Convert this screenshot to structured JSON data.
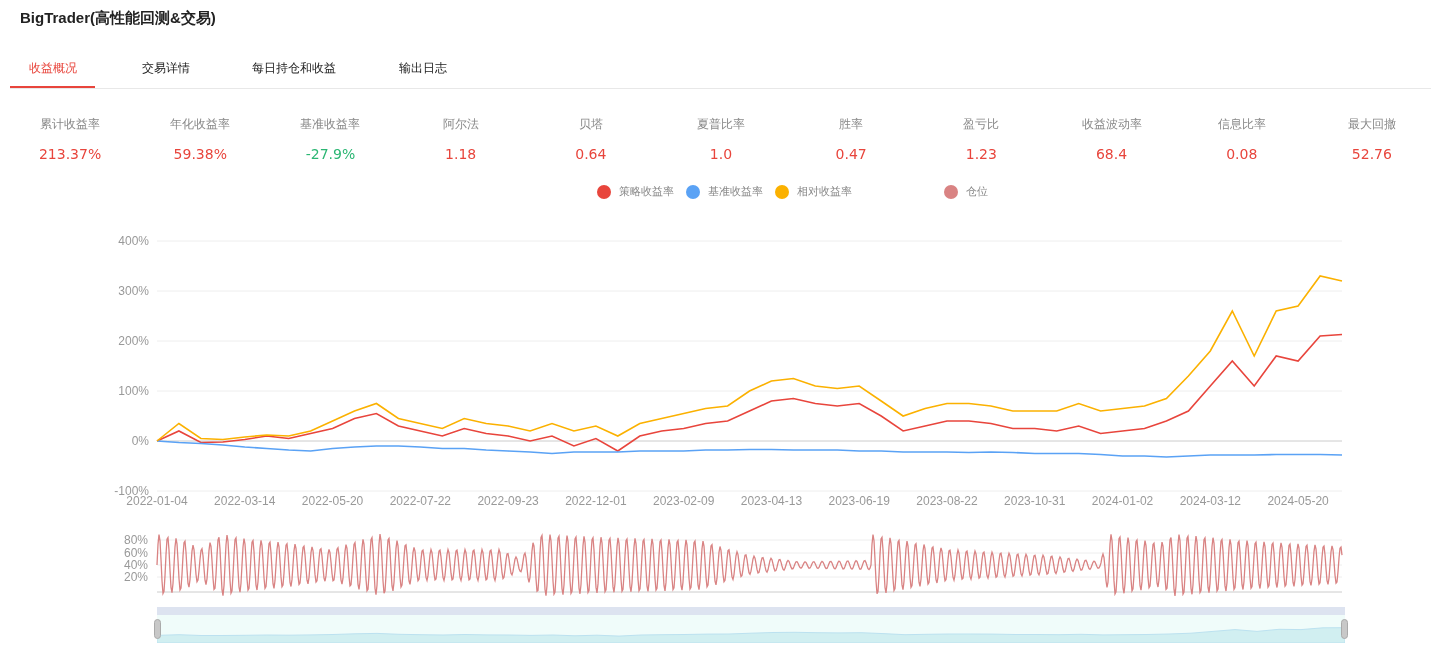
{
  "title": "BigTrader(高性能回测&交易)",
  "tabs": [
    {
      "label": "收益概况",
      "selected": true
    },
    {
      "label": "交易详情",
      "selected": false
    },
    {
      "label": "每日持仓和收益",
      "selected": false
    },
    {
      "label": "输出日志",
      "selected": false
    }
  ],
  "metrics": [
    {
      "label": "累计收益率",
      "value": "213.37%",
      "color": "#e8453c"
    },
    {
      "label": "年化收益率",
      "value": "59.38%",
      "color": "#e8453c"
    },
    {
      "label": "基准收益率",
      "value": "-27.9%",
      "color": "#2bb673"
    },
    {
      "label": "阿尔法",
      "value": "1.18",
      "color": "#e8453c"
    },
    {
      "label": "贝塔",
      "value": "0.64",
      "color": "#e8453c"
    },
    {
      "label": "夏普比率",
      "value": "1.0",
      "color": "#e8453c"
    },
    {
      "label": "胜率",
      "value": "0.47",
      "color": "#e8453c"
    },
    {
      "label": "盈亏比",
      "value": "1.23",
      "color": "#e8453c"
    },
    {
      "label": "收益波动率",
      "value": "68.4",
      "color": "#e8453c"
    },
    {
      "label": "信息比率",
      "value": "0.08",
      "color": "#e8453c"
    },
    {
      "label": "最大回撤",
      "value": "52.76",
      "color": "#e8453c"
    }
  ],
  "chart_data": {
    "type": "line",
    "grid": true,
    "ylim": [
      -100,
      400
    ],
    "categories": [
      "2022-01-04",
      null,
      null,
      null,
      "2022-03-14",
      null,
      null,
      null,
      "2022-05-20",
      null,
      null,
      null,
      "2022-07-22",
      null,
      null,
      null,
      "2022-09-23",
      null,
      null,
      null,
      "2022-12-01",
      null,
      null,
      null,
      "2023-02-09",
      null,
      null,
      null,
      "2023-04-13",
      null,
      null,
      null,
      "2023-06-19",
      null,
      null,
      null,
      "2023-08-22",
      null,
      null,
      null,
      "2023-10-31",
      null,
      null,
      null,
      "2024-01-02",
      null,
      null,
      null,
      "2024-03-12",
      null,
      null,
      null,
      "2024-05-20",
      null,
      null
    ],
    "yticks": [
      {
        "value": 400,
        "label": "400%"
      },
      {
        "value": 300,
        "label": "300%"
      },
      {
        "value": 200,
        "label": "200%"
      },
      {
        "value": 100,
        "label": "100%"
      },
      {
        "value": 0,
        "label": "0%"
      },
      {
        "value": -100,
        "label": "-100%"
      }
    ],
    "series": [
      {
        "name": "策略收益率",
        "color": "#e8453c",
        "values": [
          0,
          20,
          -3,
          -2,
          3,
          10,
          5,
          15,
          25,
          45,
          55,
          30,
          20,
          10,
          25,
          15,
          10,
          0,
          10,
          -10,
          5,
          -20,
          10,
          20,
          25,
          35,
          40,
          60,
          80,
          85,
          75,
          70,
          75,
          50,
          20,
          30,
          40,
          40,
          35,
          25,
          25,
          20,
          30,
          15,
          20,
          25,
          40,
          60,
          110,
          160,
          110,
          170,
          160,
          210,
          213
        ]
      },
      {
        "name": "基准收益率",
        "color": "#5aa2f5",
        "values": [
          0,
          -3,
          -5,
          -8,
          -12,
          -15,
          -18,
          -20,
          -15,
          -12,
          -10,
          -10,
          -12,
          -15,
          -15,
          -18,
          -20,
          -22,
          -25,
          -22,
          -22,
          -22,
          -20,
          -20,
          -20,
          -18,
          -18,
          -17,
          -17,
          -18,
          -18,
          -18,
          -20,
          -20,
          -22,
          -22,
          -22,
          -23,
          -22,
          -23,
          -25,
          -25,
          -25,
          -27,
          -30,
          -30,
          -32,
          -30,
          -28,
          -28,
          -28,
          -27,
          -27,
          -27,
          -28
        ]
      },
      {
        "name": "相对收益率",
        "color": "#fbb100",
        "values": [
          0,
          35,
          5,
          3,
          8,
          12,
          10,
          20,
          40,
          60,
          75,
          45,
          35,
          25,
          45,
          35,
          30,
          20,
          35,
          20,
          30,
          10,
          35,
          45,
          55,
          65,
          70,
          100,
          120,
          125,
          110,
          105,
          110,
          80,
          50,
          65,
          75,
          75,
          70,
          60,
          60,
          60,
          75,
          60,
          65,
          70,
          85,
          130,
          180,
          260,
          170,
          260,
          270,
          330,
          320
        ]
      }
    ]
  },
  "position_chart": {
    "legend_label": "仓位",
    "color": "#d98383",
    "ytick_labels": [
      "80%",
      "60%",
      "40%",
      "20%"
    ]
  },
  "zoom_slider": {
    "level": 1
  }
}
